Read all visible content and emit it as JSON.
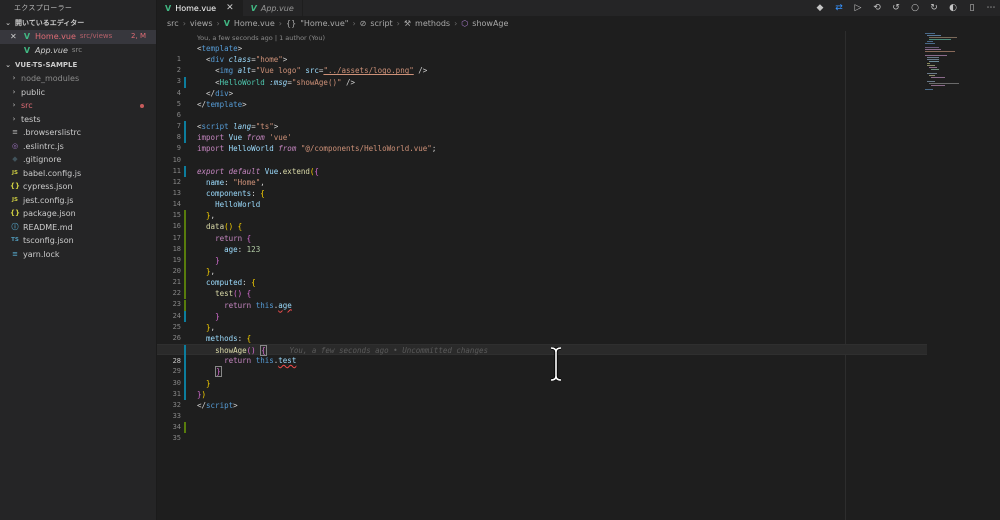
{
  "sidebar": {
    "title": "エクスプローラー",
    "open_editors": {
      "header": "開いているエディター",
      "items": [
        {
          "close": "✕",
          "name": "Home.vue",
          "path": "src/views",
          "badge": "2, M"
        },
        {
          "name": "App.vue",
          "path": "src"
        }
      ]
    },
    "project": {
      "header": "VUE-TS-SAMPLE",
      "items": [
        {
          "name": "node_modules",
          "type": "folder"
        },
        {
          "name": "public",
          "type": "folder"
        },
        {
          "name": "src",
          "type": "folder"
        },
        {
          "name": "tests",
          "type": "folder"
        },
        {
          "name": ".browserslistrc",
          "type": "file",
          "icon": "≡"
        },
        {
          "name": ".eslintrc.js",
          "type": "file",
          "icon": "◎"
        },
        {
          "name": ".gitignore",
          "type": "file",
          "icon": "◆"
        },
        {
          "name": "babel.config.js",
          "type": "file",
          "icon": "JS"
        },
        {
          "name": "cypress.json",
          "type": "file",
          "icon": "{}"
        },
        {
          "name": "jest.config.js",
          "type": "file",
          "icon": "JS"
        },
        {
          "name": "package.json",
          "type": "file",
          "icon": "{}"
        },
        {
          "name": "README.md",
          "type": "file",
          "icon": "ⓘ"
        },
        {
          "name": "tsconfig.json",
          "type": "file",
          "icon": "TS"
        },
        {
          "name": "yarn.lock",
          "type": "file",
          "icon": "≡"
        }
      ]
    }
  },
  "tabs": [
    {
      "name": "Home.vue",
      "active": true,
      "close": "✕"
    },
    {
      "name": "App.vue",
      "active": false
    }
  ],
  "breadcrumb": {
    "parts": [
      "src",
      "views",
      "Home.vue",
      "\"Home.vue\"",
      "script",
      "methods",
      "showAge"
    ]
  },
  "editor": {
    "codelens": "You, a few seconds ago | 1 author (You)",
    "blame": "You, a few seconds ago • Uncommitted changes",
    "line_numbers": [
      "1",
      "2",
      "3",
      "4",
      "5",
      "6",
      "7",
      "8",
      "9",
      "10",
      "11",
      "12",
      "13",
      "14",
      "15",
      "16",
      "17",
      "18",
      "19",
      "20",
      "21",
      "22",
      "23",
      "24",
      "25",
      "26",
      "27",
      "28",
      "29",
      "30",
      "31",
      "32",
      "33",
      "34",
      "35"
    ],
    "tokens": {
      "template": "template",
      "div": "div",
      "class": "class",
      "home": "\"home\"",
      "img": "img",
      "alt": "alt",
      "vue_logo": "\"Vue logo\"",
      "src": "src",
      "logo_path": "\"../assets/logo.png\"",
      "helloworld": "HelloWorld",
      "msg": ":msg",
      "showage_call": "\"showAge()\"",
      "script": "script",
      "lang": "lang",
      "ts": "\"ts\"",
      "import": "import",
      "from": "from",
      "vue": "Vue",
      "vue_str": "'vue'",
      "hw_path": "\"@/components/HelloWorld.vue\"",
      "export": "export",
      "default": "default",
      "extend": "extend",
      "name_key": "name",
      "home_str": "\"Home\"",
      "components": "components",
      "data": "data",
      "return": "return",
      "age": "age",
      "n123": "123",
      "computed": "computed",
      "test": "test",
      "this": "this",
      "methods": "methods",
      "showage": "showAge"
    }
  }
}
